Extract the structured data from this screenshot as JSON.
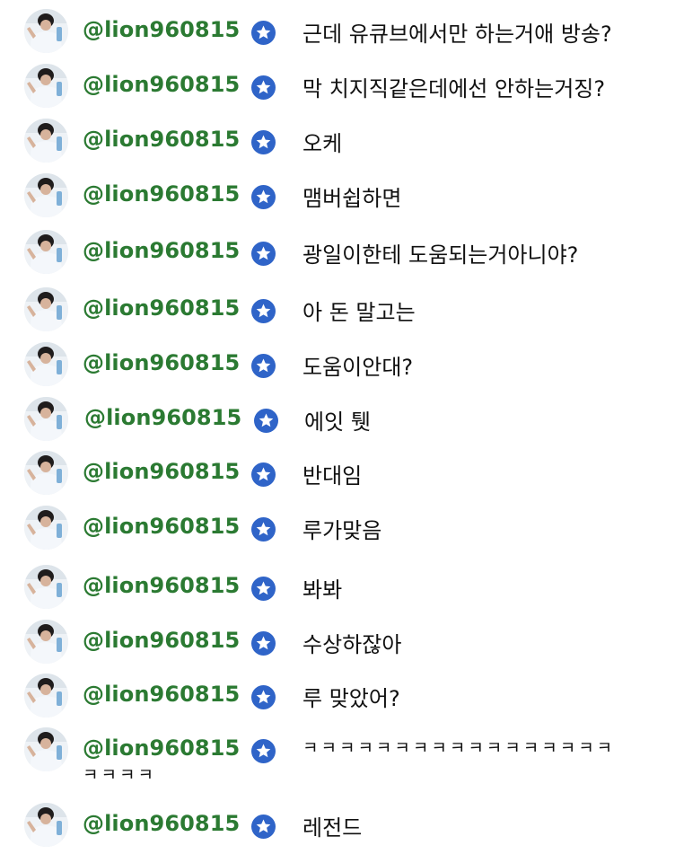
{
  "chat": {
    "messages": [
      {
        "username": "@lion960815",
        "text": "근데 유큐브에서만 하는거애 방송?"
      },
      {
        "username": "@lion960815",
        "text": "막 치지직같은데에선 안하는거징?"
      },
      {
        "username": "@lion960815",
        "text": "오케"
      },
      {
        "username": "@lion960815",
        "text": "맴버쉽하면"
      },
      {
        "username": "@lion960815",
        "text": "광일이한테 도움되는거아니야?"
      },
      {
        "username": "@lion960815",
        "text": "아 돈 말고는"
      },
      {
        "username": "@lion960815",
        "text": "도움이안대?"
      },
      {
        "username": "@lion960815",
        "text": "에잇 퉷"
      },
      {
        "username": "@lion960815",
        "text": "반대임"
      },
      {
        "username": "@lion960815",
        "text": "루가맞음"
      },
      {
        "username": "@lion960815",
        "text": "봐봐"
      },
      {
        "username": "@lion960815",
        "text": "수상하잖아"
      },
      {
        "username": "@lion960815",
        "text": "루 맞았어?"
      },
      {
        "username": "@lion960815",
        "text_line1": "ㅋㅋㅋㅋㅋㅋㅋㅋㅋㅋㅋㅋㅋㅋㅋㅋㅋ",
        "text_line2": "ㅋㅋㅋㅋ"
      },
      {
        "username": "@lion960815",
        "text": "레전드"
      }
    ],
    "colors": {
      "username": "#2b7a32",
      "badge": "#2f64c8",
      "message": "#111111"
    },
    "icons": {
      "badge": "star-badge-icon",
      "avatar": "user-avatar"
    }
  }
}
